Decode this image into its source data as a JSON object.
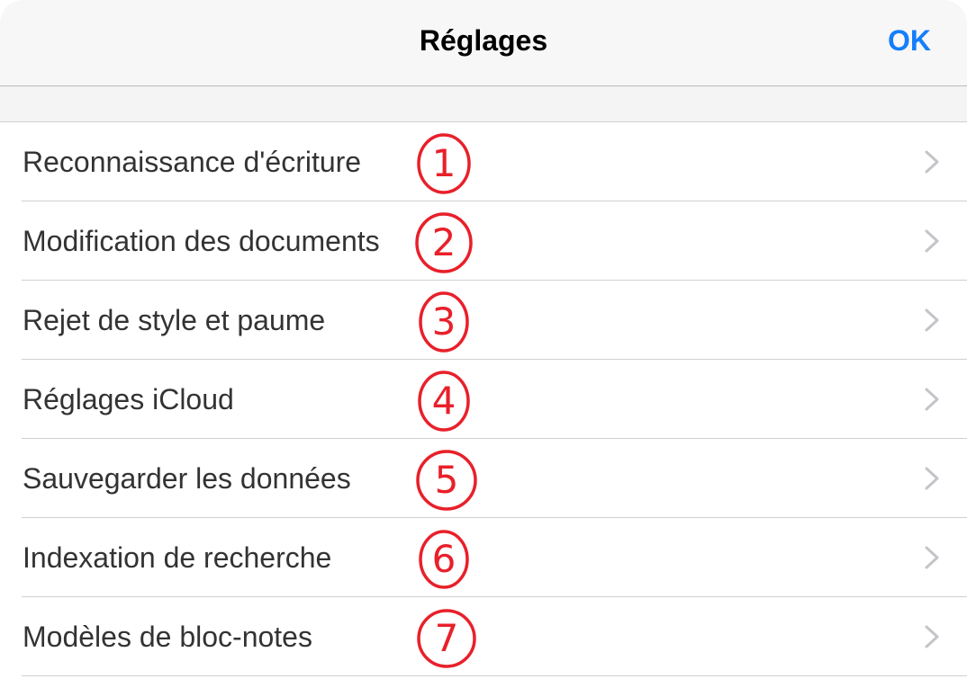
{
  "header": {
    "title": "Réglages",
    "ok_label": "OK"
  },
  "colors": {
    "accent": "#147efb",
    "annotation": "#e8202a"
  },
  "settings": {
    "items": [
      {
        "label": "Reconnaissance d'écriture",
        "badge": "1"
      },
      {
        "label": "Modification des documents",
        "badge": "2"
      },
      {
        "label": "Rejet de style et paume",
        "badge": "3"
      },
      {
        "label": "Réglages iCloud",
        "badge": "4"
      },
      {
        "label": "Sauvegarder les données",
        "badge": "5"
      },
      {
        "label": "Indexation de recherche",
        "badge": "6"
      },
      {
        "label": "Modèles de bloc-notes",
        "badge": "7"
      }
    ]
  }
}
